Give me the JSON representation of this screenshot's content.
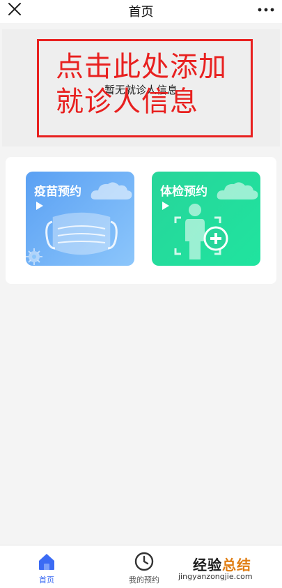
{
  "header": {
    "title": "首页",
    "close_icon": "close-icon",
    "more_icon": "more-dots-icon"
  },
  "patient": {
    "empty_text": "暂无就诊人信息",
    "annotation": "点击此处添加就诊人信息",
    "annotation_color": "#e8201f"
  },
  "services": [
    {
      "label": "疫苗预约",
      "icon": "mask-icon",
      "color": "#5aa0f3"
    },
    {
      "label": "体检预约",
      "icon": "body-check-icon",
      "color": "#27d59a"
    }
  ],
  "tabbar": {
    "items": [
      {
        "label": "首页",
        "icon": "home-icon",
        "active": true,
        "color": "#3b6bf4"
      },
      {
        "label": "我的预约",
        "icon": "clock-icon",
        "active": false,
        "color": "#555555"
      }
    ]
  },
  "watermark": {
    "main": "经验",
    "accent": "总结",
    "url": "jingyanzongjie.com"
  }
}
